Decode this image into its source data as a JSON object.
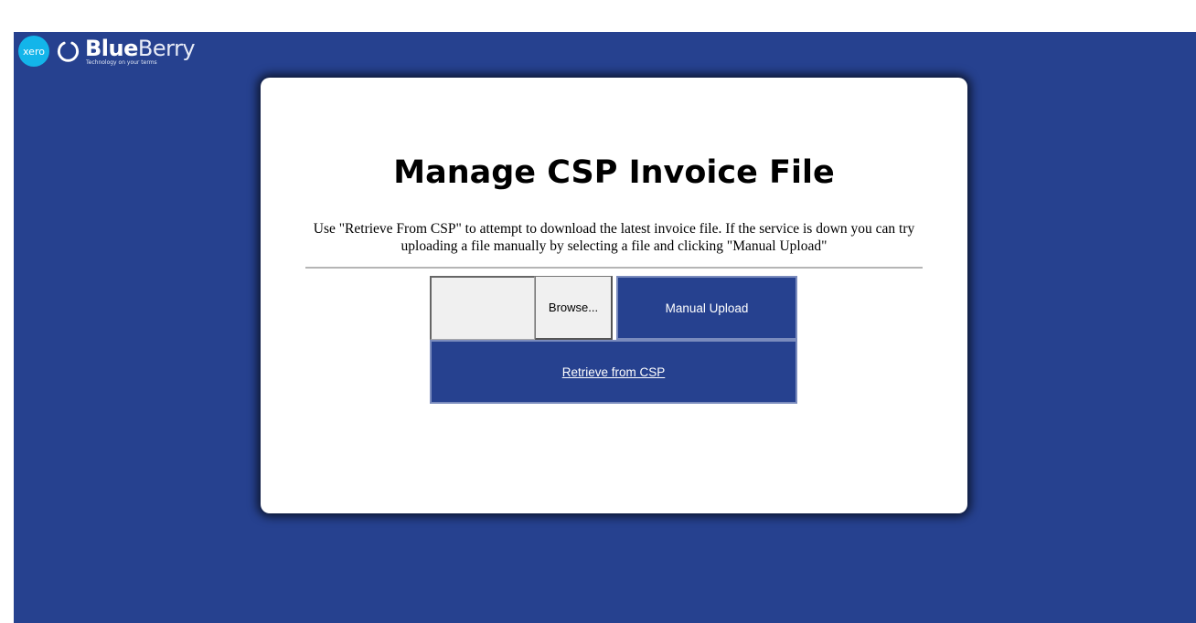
{
  "brand": {
    "xero_label": "xero",
    "name_bold": "Blue",
    "name_light": "Berry",
    "tagline": "Technology on your terms"
  },
  "colors": {
    "background": "#26418f",
    "card": "#ffffff",
    "xero_badge": "#13b5ea",
    "button_primary": "#26418f"
  },
  "card": {
    "title": "Manage CSP Invoice File",
    "description": "Use \"Retrieve From CSP\" to attempt to download the latest invoice file. If the service is down you can try uploading a file manually by selecting a file and clicking \"Manual Upload\""
  },
  "controls": {
    "browse_label": "Browse...",
    "manual_upload_label": "Manual Upload",
    "retrieve_label": "Retrieve from CSP"
  }
}
